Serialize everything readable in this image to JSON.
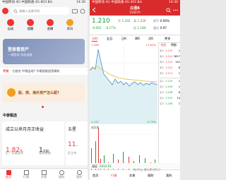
{
  "left": {
    "status_left": "中国移动 4G 中国联通 4G 803 B/s",
    "status_right": "14:30",
    "search_placeholder": "请输入证券代码",
    "quick_icons": [
      {
        "label": "自选",
        "icon": "star-icon"
      },
      {
        "label": "提醒",
        "icon": "bell-icon"
      },
      {
        "label": "直播",
        "icon": "video-icon"
      },
      {
        "label": "资讯",
        "icon": "diamond-icon"
      }
    ],
    "banner_title": "登录看资产",
    "banner_sub": "一键登录 轻松查看",
    "news_tag": "平安",
    "news_text": "七般合 中报出现? 中泰智能投资解析",
    "promo_text": "股、债、海外资产怎么配?",
    "section_title": "中泰甄选",
    "card1_title": "成立以来月月正收益",
    "card1_value": "1.82",
    "card1_unit": "%",
    "card1_value2": "1",
    "card1_value2_unit": "天起",
    "card1_label1": "近一月收益率",
    "card1_label2": "理财期限",
    "card2_title": "五星",
    "card2_value": "11.",
    "card2_label": "近三年",
    "bottom_nav": [
      "首页",
      "行情",
      "交易",
      "理财",
      "我的"
    ]
  },
  "right": {
    "status_left": "中国移动 4G 中国联通 4G 403 B/s",
    "status_right": "14:30",
    "stock_name": "白酒B",
    "stock_code": "150270",
    "price": "1.210",
    "change": "-0.002",
    "change_pct": "-0.17%",
    "open_label": "开",
    "open_value": "1.202",
    "high_label": "高",
    "high_value": "1.226",
    "low_label": "低",
    "low_value": "1.180",
    "turnover_label": "换手",
    "turnover_value": "0.00%",
    "volume_label": "量比",
    "volume_value": "0.97",
    "tabs": [
      "分时",
      "五日",
      "日K",
      "周K",
      "月K",
      "更多"
    ],
    "price_top": "1.256",
    "price_bottom": "1.142",
    "pct_top": "+3.62%",
    "pct_bottom": "-5.73%",
    "book_header": [
      "档位",
      "明细"
    ],
    "asks": [
      {
        "label": "卖5",
        "price": "1.215",
        "vol": "1"
      },
      {
        "label": "卖4",
        "price": "1.214",
        "vol": "3657"
      },
      {
        "label": "卖3",
        "price": "1.213",
        "vol": "142"
      },
      {
        "label": "卖2",
        "price": "1.212",
        "vol": "8"
      },
      {
        "label": "卖1",
        "price": "1.211",
        "vol": "1"
      }
    ],
    "bids": [
      {
        "label": "买1",
        "price": "1.210",
        "vol": "1"
      },
      {
        "label": "买2",
        "price": "1.209",
        "vol": "1"
      },
      {
        "label": "买3",
        "price": "1.208",
        "vol": "6"
      },
      {
        "label": "买4",
        "price": "1.207",
        "vol": "14"
      },
      {
        "label": "买5",
        "price": "1.206",
        "vol": "1"
      }
    ],
    "vol_label": "成交量",
    "index_name": "深证",
    "index_value": "9414.63",
    "bottom_nav": [
      "首页",
      "行情",
      "交易",
      "理财",
      "我的"
    ],
    "watermark": "知乎 @ 诸同学在学习"
  }
}
